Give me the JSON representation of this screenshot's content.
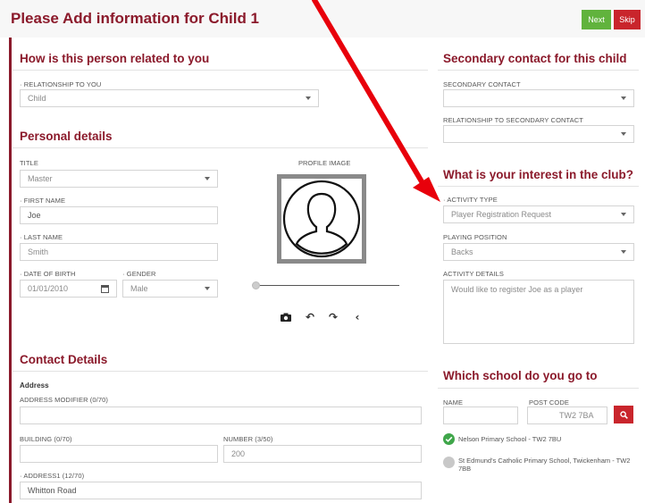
{
  "header": {
    "title": "Please Add information for Child 1",
    "next_label": "Next",
    "skip_label": "Skip"
  },
  "relation": {
    "heading": "How is this person related to you",
    "relationship_label": "· RELATIONSHIP TO YOU",
    "relationship_value": "Child"
  },
  "personal": {
    "heading": "Personal details",
    "title_label": "TITLE",
    "title_value": "Master",
    "first_name_label": "· FIRST NAME",
    "first_name_value": "Joe",
    "last_name_label": "· LAST NAME",
    "last_name_value": "Smith",
    "dob_label": "· DATE OF BIRTH",
    "dob_value": "01/01/2010",
    "gender_label": "· GENDER",
    "gender_value": "Male",
    "profile_image_label": "PROFILE IMAGE"
  },
  "contact": {
    "heading": "Contact Details",
    "address_heading": "Address",
    "address_modifier_label": "ADDRESS MODIFIER (0/70)",
    "address_modifier_value": "",
    "building_label": "BUILDING (0/70)",
    "building_value": "",
    "number_label": "NUMBER (3/50)",
    "number_value": "200",
    "address1_label": "· ADDRESS1 (12/70)",
    "address1_value": "Whitton Road"
  },
  "secondary": {
    "heading": "Secondary contact for this child",
    "contact_label": "SECONDARY CONTACT",
    "contact_value": "",
    "relationship_label": "RELATIONSHIP TO SECONDARY CONTACT",
    "relationship_value": ""
  },
  "interest": {
    "heading": "What is your interest in the club?",
    "activity_type_label": "· ACTIVITY TYPE",
    "activity_type_value": "Player Registration Request",
    "playing_position_label": "PLAYING POSITION",
    "playing_position_value": "Backs",
    "activity_details_label": "ACTIVITY DETAILS",
    "activity_details_value": "Would like to register Joe as a player"
  },
  "school": {
    "heading": "Which school do you go to",
    "name_label": "NAME",
    "name_value": "",
    "postcode_label": "POST CODE",
    "postcode_value": "TW2 7BA",
    "results": [
      {
        "name": "Nelson Primary School - TW2 7BU",
        "selected": true
      },
      {
        "name": "St Edmund's Catholic Primary School, Twickenham - TW2 7BB",
        "selected": false
      }
    ]
  },
  "colors": {
    "brand": "#8b1a2b",
    "next_button": "#61b33d",
    "skip_button": "#c9252c",
    "annotation_arrow": "#e8000b",
    "selected_check": "#3fa64a"
  },
  "icons": {
    "camera": "camera-icon",
    "rotate_left": "rotate-left-icon",
    "rotate_right": "rotate-right-icon",
    "back": "chevron-left-icon",
    "search": "search-icon",
    "calendar": "calendar-icon"
  }
}
